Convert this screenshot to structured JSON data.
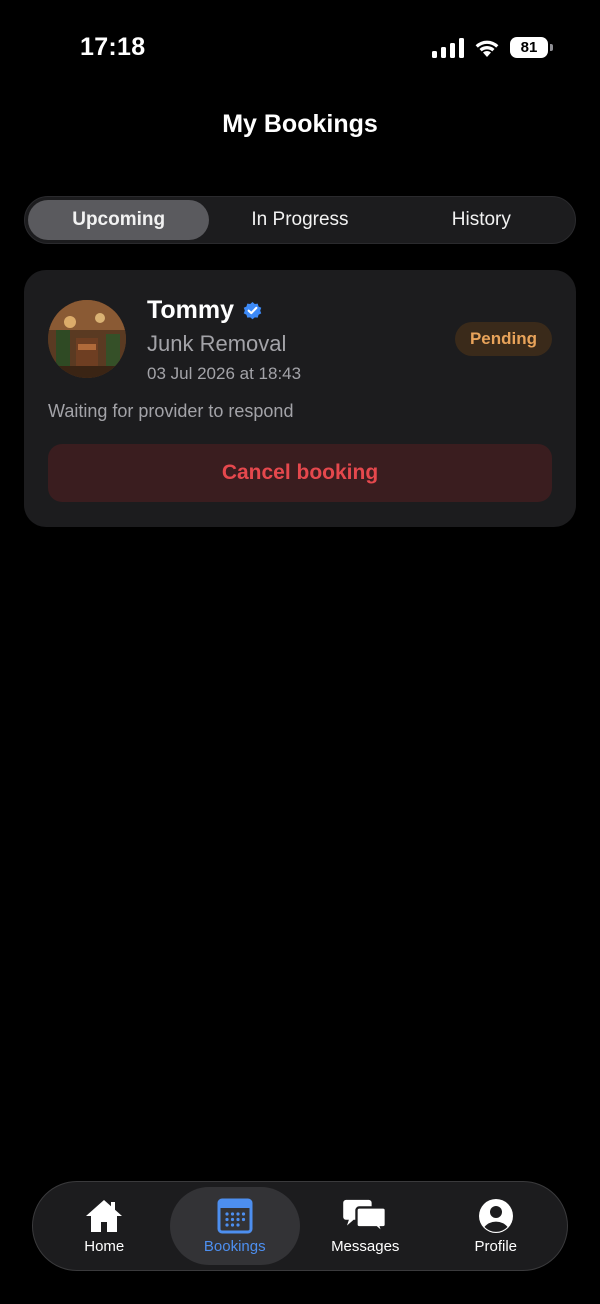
{
  "status_bar": {
    "time": "17:18",
    "battery": "81"
  },
  "header": {
    "title": "My Bookings"
  },
  "segments": [
    {
      "label": "Upcoming",
      "active": true
    },
    {
      "label": "In Progress",
      "active": false
    },
    {
      "label": "History",
      "active": false
    }
  ],
  "booking": {
    "provider_name": "Tommy",
    "service": "Junk Removal",
    "datetime": "03 Jul 2026 at 18:43",
    "status": "Pending",
    "message": "Waiting for provider to respond",
    "cancel_label": "Cancel booking"
  },
  "tabbar": {
    "items": [
      {
        "label": "Home",
        "icon": "home-icon",
        "active": false
      },
      {
        "label": "Bookings",
        "icon": "calendar-icon",
        "active": true
      },
      {
        "label": "Messages",
        "icon": "chat-bubbles-icon",
        "active": false
      },
      {
        "label": "Profile",
        "icon": "person-circle-icon",
        "active": false
      }
    ]
  },
  "colors": {
    "accent_blue": "#4d8ff0",
    "pending_text": "#e8a35a",
    "danger_red": "#e5484d",
    "card_bg": "#1c1c1e"
  }
}
